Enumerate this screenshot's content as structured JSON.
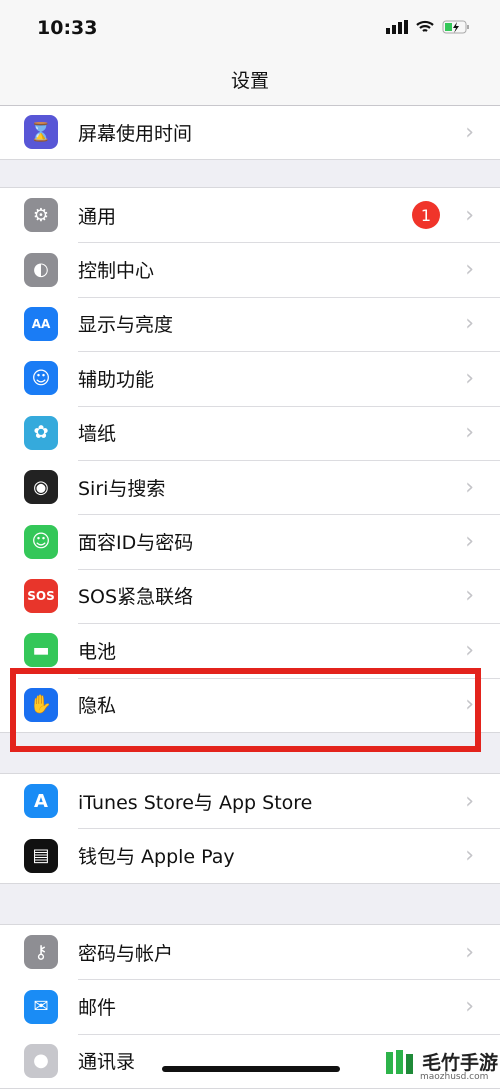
{
  "status": {
    "time": "10:33"
  },
  "nav": {
    "title": "设置"
  },
  "groups": [
    [
      {
        "label": "屏幕使用时间",
        "icon": "hourglass-icon",
        "color": "#5856d6"
      }
    ],
    [
      {
        "label": "通用",
        "icon": "gear-icon",
        "color": "#8e8e93",
        "badge": "1"
      },
      {
        "label": "控制中心",
        "icon": "toggle-icon",
        "color": "#8e8e93"
      },
      {
        "label": "显示与亮度",
        "icon": "text-size-icon",
        "color": "#1a7cf5"
      },
      {
        "label": "辅助功能",
        "icon": "accessibility-icon",
        "color": "#1a7cf5"
      },
      {
        "label": "墙纸",
        "icon": "flower-icon",
        "color": "#35aadc"
      },
      {
        "label": "Siri与搜索",
        "icon": "siri-icon",
        "color": "#222"
      },
      {
        "label": "面容ID与密码",
        "icon": "face-id-icon",
        "color": "#34c759"
      },
      {
        "label": "SOS紧急联络",
        "icon": "sos-icon",
        "color": "#e8352b"
      },
      {
        "label": "电池",
        "icon": "battery-icon",
        "color": "#34c759"
      },
      {
        "label": "隐私",
        "icon": "hand-icon",
        "color": "#1a6ff0"
      }
    ],
    [
      {
        "label": "iTunes Store与 App Store",
        "icon": "app-store-icon",
        "color": "#1a8cf5"
      },
      {
        "label": "钱包与 Apple Pay",
        "icon": "wallet-icon",
        "color": "#111"
      }
    ],
    [
      {
        "label": "密码与帐户",
        "icon": "key-icon",
        "color": "#8e8e93"
      },
      {
        "label": "邮件",
        "icon": "mail-icon",
        "color": "#1a8cf5"
      },
      {
        "label": "通讯录",
        "icon": "contacts-icon",
        "color": "#c7c7cc"
      }
    ]
  ],
  "watermark": {
    "text": "毛竹手游",
    "url": "maozhusd.com"
  }
}
